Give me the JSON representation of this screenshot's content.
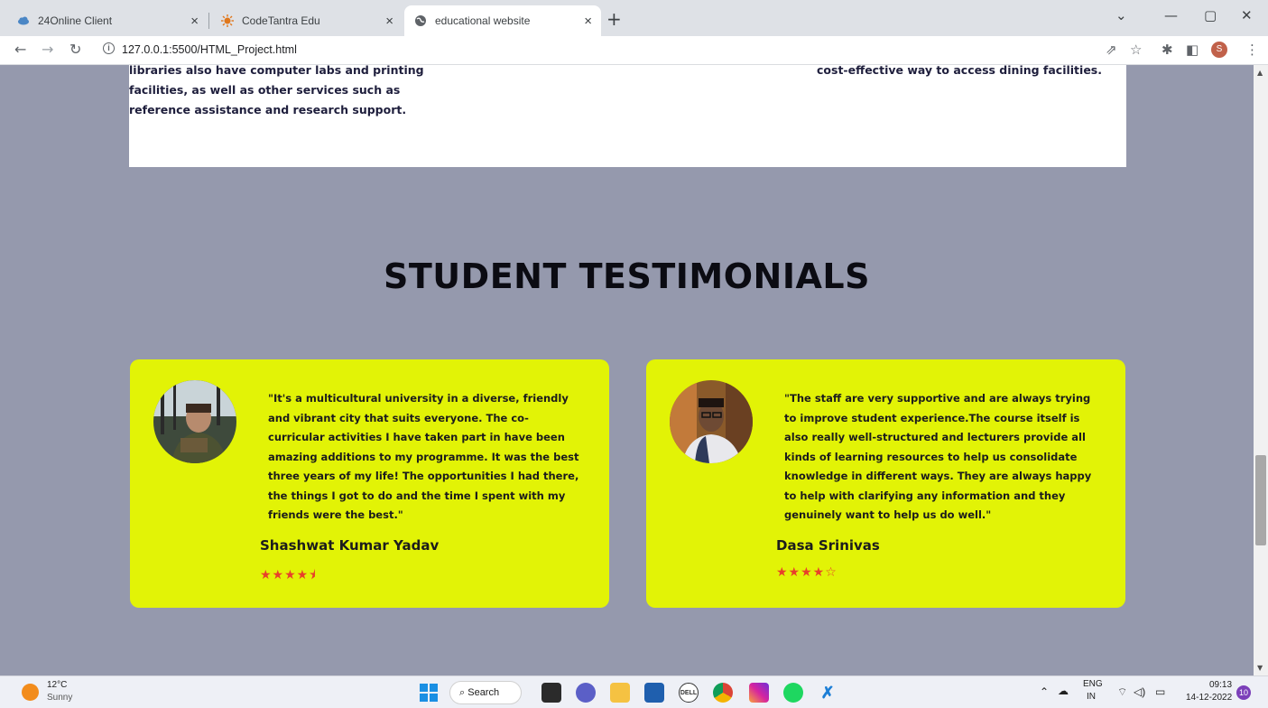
{
  "browser": {
    "tabs": [
      {
        "title": "24Online Client",
        "favicon": "cloud-icon",
        "active": false
      },
      {
        "title": "CodeTantra Edu",
        "favicon": "sun-logo-icon",
        "active": false
      },
      {
        "title": "educational website",
        "favicon": "globe-icon",
        "active": true
      }
    ],
    "url": "127.0.0.1:5500/HTML_Project.html",
    "profile_initial": "S"
  },
  "page": {
    "facilities": {
      "left_text": "libraries also have computer labs and printing facilities, as well as other services such as reference assistance and research support.",
      "right_text": "cost-effective way to access dining facilities."
    },
    "section_title": "STUDENT TESTIMONIALS",
    "testimonials": [
      {
        "quote": "\"It's a multicultural university in a diverse, friendly and vibrant city that suits everyone. The co-curricular activities I have taken part in have been amazing additions to my programme. It was the best three years of my life! The opportunities I had there, the things I got to do and the time I spent with my friends were the best.\"",
        "name": "Shashwat Kumar Yadav",
        "stars": "★★★★⯨",
        "rating": 4.5
      },
      {
        "quote": "\"The staff are very supportive and are always trying to improve student experience.The course itself is also really well-structured and lecturers provide all kinds of learning resources to help us consolidate knowledge in different ways. They are always happy to help with clarifying any information and they genuinely want to help us do well.\"",
        "name": "Dasa Srinivas",
        "stars": "★★★★☆",
        "rating": 4
      }
    ],
    "colors": {
      "page_bg": "#9599ad",
      "card_bg": "#e2f306",
      "star": "#e8402a"
    }
  },
  "taskbar": {
    "weather_temp": "12°C",
    "weather_condition": "Sunny",
    "search_label": "Search",
    "language": "ENG",
    "region": "IN",
    "time": "09:13",
    "date": "14-12-2022",
    "notifications": "10"
  }
}
